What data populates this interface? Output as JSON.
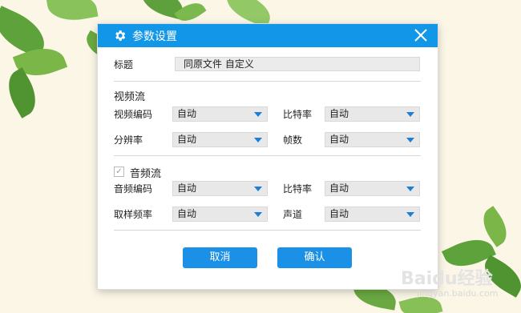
{
  "dialog": {
    "title": "参数设置",
    "title_label": "标题",
    "title_value": "同原文件 自定义",
    "video": {
      "section": "视频流",
      "codec_label": "视频编码",
      "codec_value": "自动",
      "bitrate_label": "比特率",
      "bitrate_value": "自动",
      "resolution_label": "分辨率",
      "resolution_value": "自动",
      "fps_label": "帧数",
      "fps_value": "自动"
    },
    "audio": {
      "section": "音频流",
      "enabled": true,
      "codec_label": "音频编码",
      "codec_value": "自动",
      "bitrate_label": "比特率",
      "bitrate_value": "自动",
      "samplerate_label": "取样频率",
      "samplerate_value": "自动",
      "channels_label": "声道",
      "channels_value": "自动"
    },
    "cancel_label": "取消",
    "confirm_label": "确认"
  },
  "watermark": {
    "brand": "Baidu经验",
    "url": "jingyan.baidu.com"
  },
  "colors": {
    "accent": "#1296e8",
    "button": "#1a90e6",
    "background": "#fbf6e6"
  }
}
